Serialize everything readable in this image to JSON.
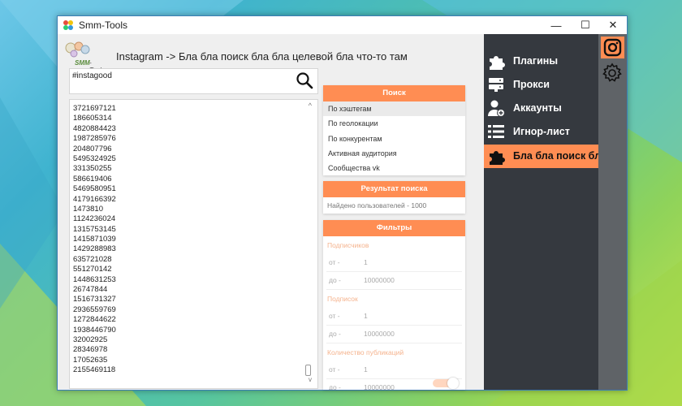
{
  "window": {
    "title": "Smm-Tools",
    "minimize_glyph": "—",
    "maximize_glyph": "☐",
    "close_glyph": "✕"
  },
  "logo": {
    "text_brand": "SMM",
    "text_tools": "-Tools"
  },
  "header": {
    "title": "Instagram -> Бла бла поиск бла бла целевой бла что-то там"
  },
  "search": {
    "value": "#instagood",
    "icon": "search-icon"
  },
  "results_list": {
    "items": [
      "3721697121",
      "186605314",
      "4820884423",
      "1987285976",
      "204807796",
      "5495324925",
      "331350255",
      "586619406",
      "5469580951",
      "4179166392",
      "1473810",
      "1124236024",
      "1315753145",
      "1415871039",
      "1429288983",
      "635721028",
      "551270142",
      "1448631253",
      "26747844",
      "1516731327",
      "2936559769",
      "1272844622",
      "1938446790",
      "32002925",
      "28346978",
      "17052635",
      "2155469118"
    ]
  },
  "search_panel": {
    "header": "Поиск",
    "options": [
      "По хэштегам",
      "По геолокации",
      "По конкурентам",
      "Активная аудитория",
      "Сообщества vk"
    ],
    "selected_index": 0
  },
  "result_panel": {
    "header": "Результат поиска",
    "text": "Найдено пользователей - 1000"
  },
  "filters_panel": {
    "header": "Фильтры",
    "groups": [
      {
        "label": "Подписчиков",
        "from_label": "от -",
        "from_value": "1",
        "to_label": "до -",
        "to_value": "10000000"
      },
      {
        "label": "Подписок",
        "from_label": "от -",
        "from_value": "1",
        "to_label": "до -",
        "to_value": "10000000"
      },
      {
        "label": "Количество публикаций",
        "from_label": "от -",
        "from_value": "1",
        "to_label": "до -",
        "to_value": "10000000"
      }
    ]
  },
  "nav": {
    "items": [
      {
        "label": "Плагины",
        "icon": "puzzle-icon"
      },
      {
        "label": "Прокси",
        "icon": "server-icon"
      },
      {
        "label": "Аккаунты",
        "icon": "add-user-icon"
      },
      {
        "label": "Игнор-лист",
        "icon": "list-icon"
      },
      {
        "label": "Бла бла поиск бла",
        "icon": "puzzle-icon"
      }
    ],
    "active_index": 4
  },
  "rail": {
    "items": [
      "instagram-icon",
      "gear-icon"
    ]
  },
  "colors": {
    "accent": "#ff8d53",
    "nav_bg": "#35393f",
    "rail_bg": "#5f6367",
    "content_bg": "#efefef"
  }
}
